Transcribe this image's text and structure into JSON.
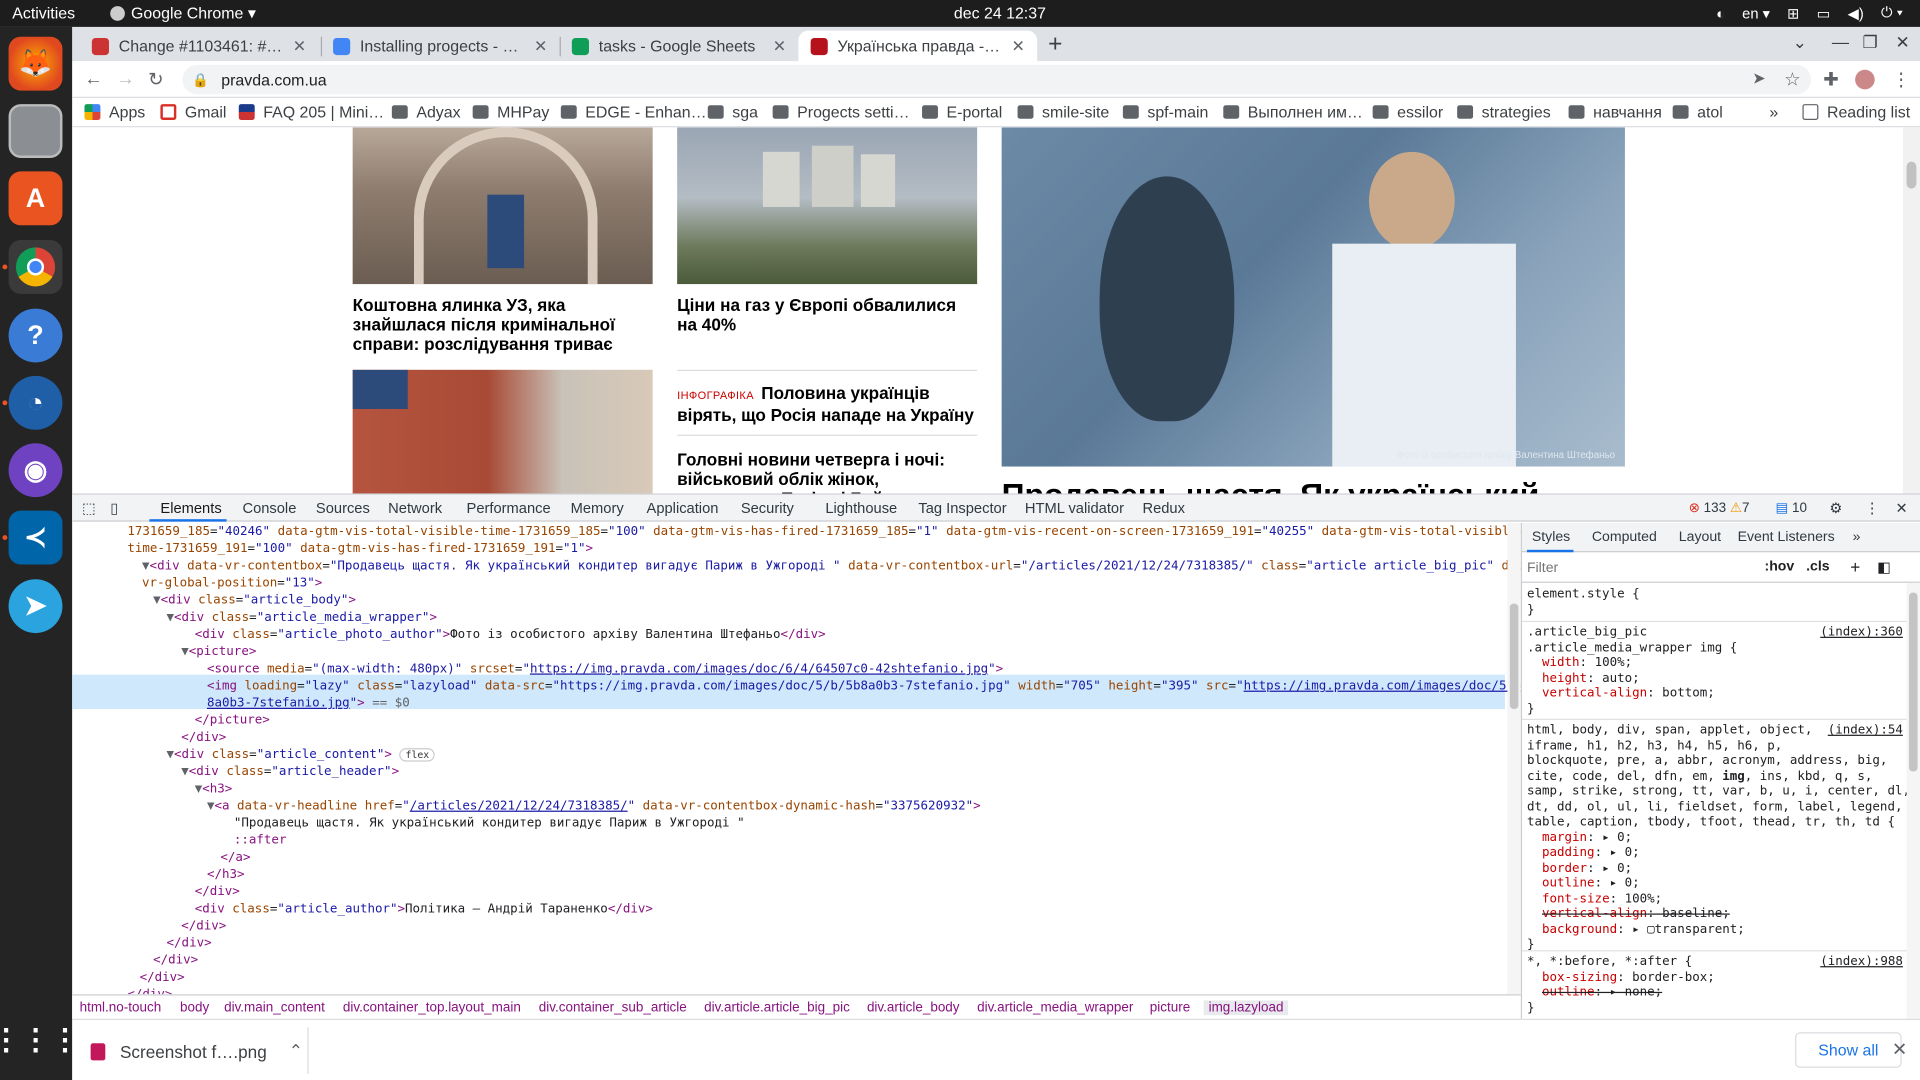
{
  "system": {
    "activities": "Activities",
    "app_menu": "Google Chrome ▾",
    "clock": "dec 24  12:37",
    "lang": "en ▾"
  },
  "tabs": [
    {
      "title": "Change #1103461: #1102…",
      "active": false
    },
    {
      "title": "Installing progects - Goog…",
      "active": false
    },
    {
      "title": "tasks - Google Sheets",
      "active": false
    },
    {
      "title": "Українська правда - нови…",
      "active": true
    }
  ],
  "address": {
    "url": "pravda.com.ua"
  },
  "bookmarks": [
    "Apps",
    "Gmail",
    "FAQ 205 | Mini…",
    "Adyax",
    "MHPay",
    "EDGE - Enhan…",
    "sga",
    "Progects setti…",
    "E-portal",
    "smile-site",
    "spf-main",
    "Выполнен им…",
    "essilor",
    "strategies",
    "навчання",
    "atol"
  ],
  "bookmarks_more": "»",
  "reading_list": "Reading list",
  "page": {
    "h1": "Коштовна ялинка УЗ, яка знайшлася після кримінальної справи: розслідування триває",
    "h2": "Ціни на газ у Європі обвалилися на 40%",
    "badge": "ІНФОГРАФІКА",
    "h3": "Половина українців вірять, що Росія нападе на Україну",
    "h4": "Головні новини четверга і ночі: військовий облік жінок, переговори Путіна і Байдена",
    "photo_credit": "Фото із особистого архіву Валентина Штефаньо",
    "big_title": "Продавець щастя. Як український"
  },
  "devtools": {
    "tabs": [
      "Elements",
      "Console",
      "Sources",
      "Network",
      "Performance",
      "Memory",
      "Application",
      "Security",
      "Lighthouse",
      "Tag Inspector",
      "HTML validator",
      "Redux"
    ],
    "errors": "133",
    "warnings": "7",
    "messages": "10",
    "styles_tabs": [
      "Styles",
      "Computed",
      "Layout",
      "Event Listeners",
      "»"
    ],
    "filter_placeholder": "Filter",
    "hov": ":hov",
    "cls": ".cls",
    "breadcrumbs": [
      "html.no-touch",
      "body",
      "div.main_content",
      "div.container_top.layout_main",
      "div.container_sub_article",
      "div.article.article_big_pic",
      "div.article_body",
      "div.article_media_wrapper",
      "picture",
      "img.lazyload"
    ]
  },
  "downloads": {
    "file": "Screenshot f….png",
    "show_all": "Show all"
  },
  "colors": {
    "accent": "#1a73e8",
    "dock": "#242424",
    "topbar": "#1d1d1d"
  }
}
